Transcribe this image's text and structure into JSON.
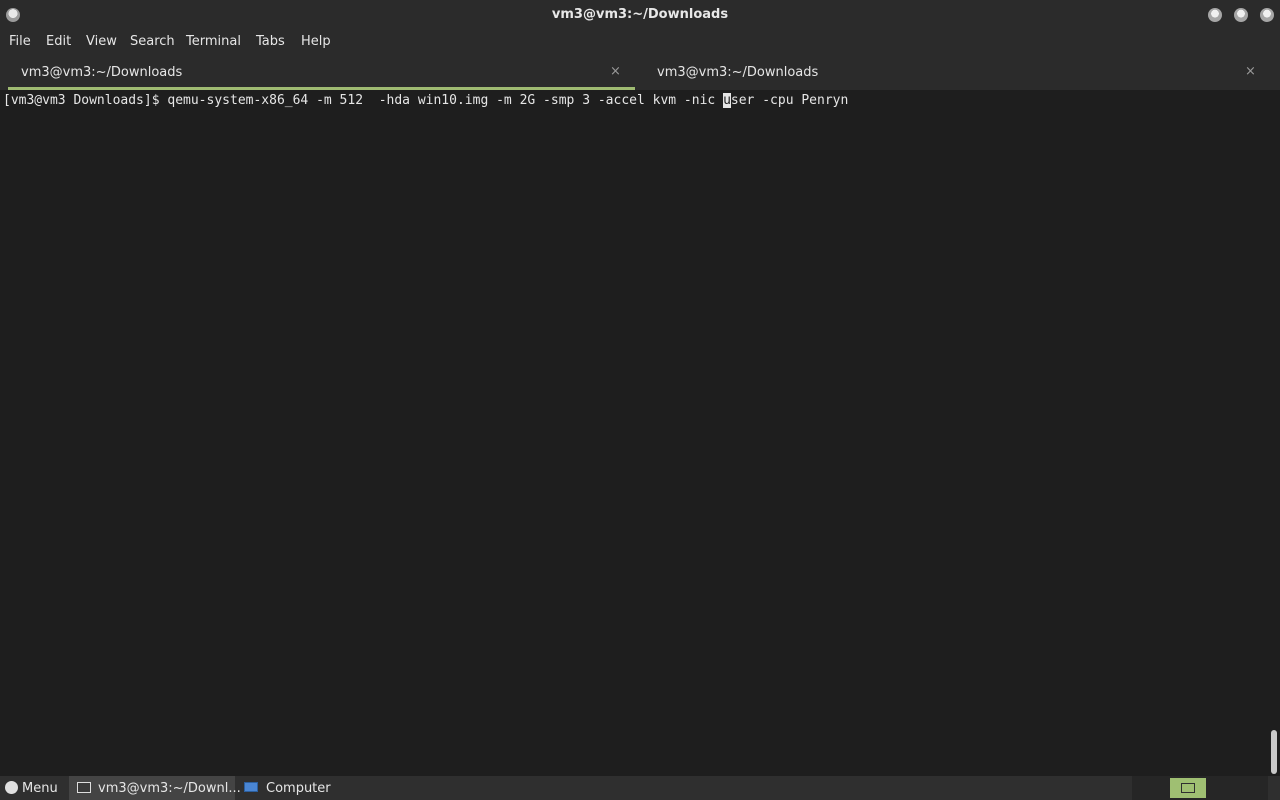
{
  "window": {
    "title": "vm3@vm3:~/Downloads"
  },
  "menubar": {
    "items": [
      "File",
      "Edit",
      "View",
      "Search",
      "Terminal",
      "Tabs",
      "Help"
    ]
  },
  "tabs": [
    {
      "label": "vm3@vm3:~/Downloads",
      "close": "×",
      "active": true
    },
    {
      "label": "vm3@vm3:~/Downloads",
      "close": "×",
      "active": false
    }
  ],
  "terminal": {
    "prompt": "[vm3@vm3 Downloads]$ ",
    "command_before_cursor": "qemu-system-x86_64 -m 512  -hda win10.img -m 2G -smp 3 -accel kvm -nic ",
    "cursor_char": "u",
    "command_after_cursor": "ser -cpu Penryn"
  },
  "taskbar": {
    "menu_label": "Menu",
    "task_label": "vm3@vm3:~/Downl...",
    "computer_label": "Computer"
  },
  "colors": {
    "accent": "#9fbb72",
    "background": "#1e1e1e",
    "chrome": "#2b2b2b"
  },
  "icons": {
    "app": "terminal-app-icon",
    "window_buttons": [
      "minimize-icon",
      "maximize-icon",
      "close-icon"
    ],
    "menu": "menu-icon",
    "task": "terminal-window-icon",
    "computer": "computer-icon",
    "workspace": "workspace-switcher-icon"
  }
}
